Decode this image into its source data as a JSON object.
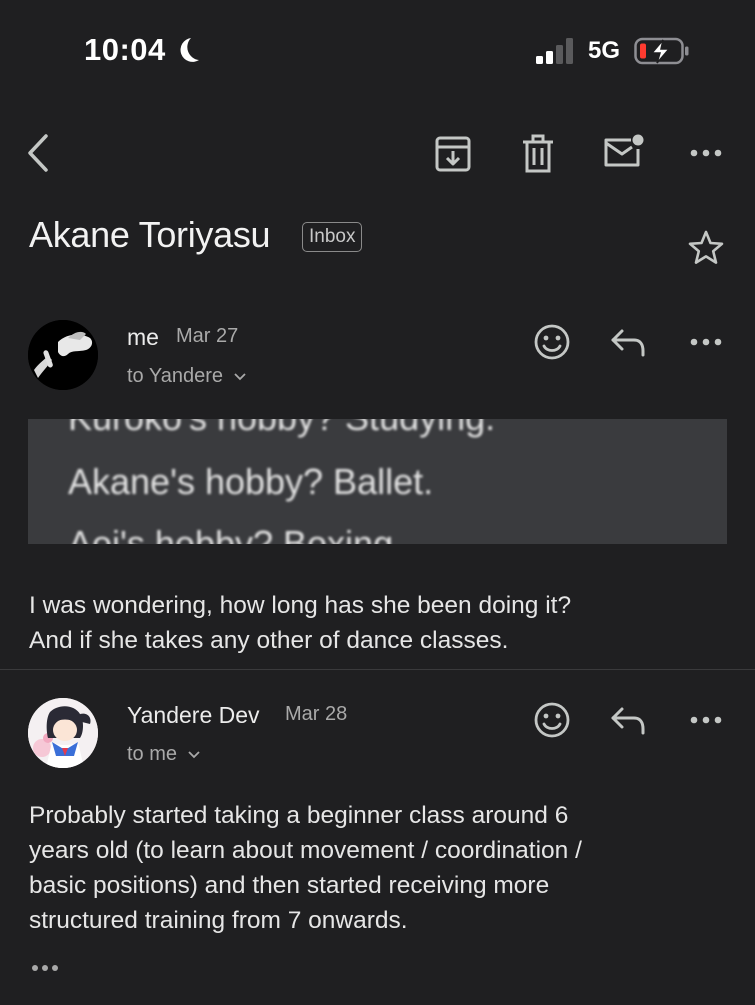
{
  "status_bar": {
    "time": "10:04",
    "network": "5G",
    "battery_charging": true,
    "battery_color": "#ff3b30",
    "moon_icon": "moon-icon",
    "signal_icon": "signal-bars-icon"
  },
  "toolbar": {
    "back_icon": "chevron-left-icon",
    "archive_icon": "archive-icon",
    "delete_icon": "trash-icon",
    "mark_unread_icon": "mail-unread-icon",
    "more_icon": "more-horizontal-icon"
  },
  "thread": {
    "subject": "Akane Toriyasu",
    "label": "Inbox",
    "star_icon": "star-outline-icon"
  },
  "messages": [
    {
      "sender": "me",
      "date": "Mar 27",
      "recipient": "to Yandere",
      "attachment_lines": [
        "Kuroko's hobby? Studying.",
        "Akane's hobby? Ballet.",
        "Aoi's hobby? Boxing."
      ],
      "body": [
        "I was wondering, how long has she been doing it?",
        "And if she takes any other of dance classes."
      ]
    },
    {
      "sender": "Yandere Dev",
      "date": "Mar 28",
      "recipient": "to me",
      "body": [
        "Probably started taking a beginner class around 6",
        "years old (to learn about movement / coordination /",
        "basic positions) and then started receiving more",
        "structured training from 7 onwards."
      ]
    }
  ],
  "colors": {
    "background": "#1f1f21",
    "text": "#e6e6e6",
    "muted": "#a9a9a9",
    "icon": "#c4c7c5"
  }
}
